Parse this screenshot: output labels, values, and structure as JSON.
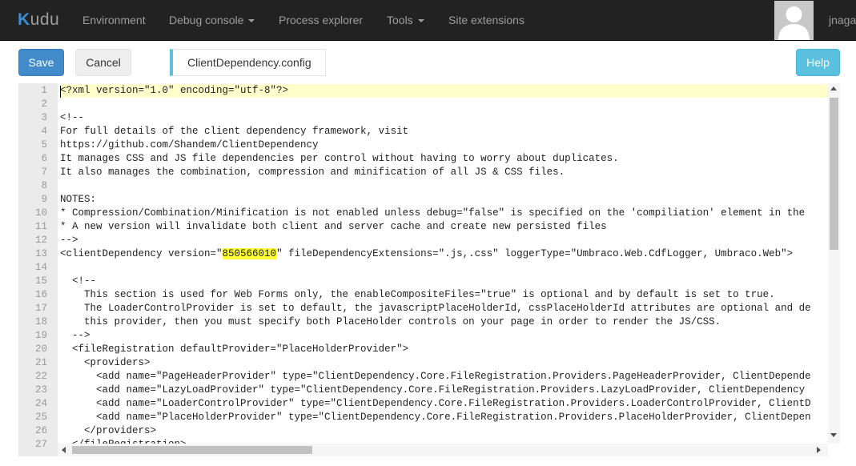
{
  "navbar": {
    "brand_first": "K",
    "brand_rest": "udu",
    "items": [
      {
        "label": "Environment",
        "dropdown": false
      },
      {
        "label": "Debug console",
        "dropdown": true
      },
      {
        "label": "Process explorer",
        "dropdown": false
      },
      {
        "label": "Tools",
        "dropdown": true
      },
      {
        "label": "Site extensions",
        "dropdown": false
      }
    ],
    "avatar_icon": "user-silhouette-icon",
    "username": "jnaga"
  },
  "toolbar": {
    "save_label": "Save",
    "cancel_label": "Cancel",
    "file_name": "ClientDependency.config",
    "help_label": "Help"
  },
  "editor": {
    "active_line": 1,
    "highlight_color": "#ffff33",
    "lines": [
      {
        "n": "1",
        "t": "<?xml version=\"1.0\" encoding=\"utf-8\"?>"
      },
      {
        "n": "2",
        "t": ""
      },
      {
        "n": "3",
        "t": "<!--"
      },
      {
        "n": "4",
        "t": "For full details of the client dependency framework, visit"
      },
      {
        "n": "5",
        "t": "https://github.com/Shandem/ClientDependency"
      },
      {
        "n": "6",
        "t": "It manages CSS and JS file dependencies per control without having to worry about duplicates."
      },
      {
        "n": "7",
        "t": "It also manages the combination, compression and minification of all JS & CSS files."
      },
      {
        "n": "8",
        "t": ""
      },
      {
        "n": "9",
        "t": "NOTES:"
      },
      {
        "n": "10",
        "t": "* Compression/Combination/Minification is not enabled unless debug=\"false\" is specified on the 'compiliation' element in the"
      },
      {
        "n": "11",
        "t": "* A new version will invalidate both client and server cache and create new persisted files"
      },
      {
        "n": "12",
        "t": "-->"
      },
      {
        "n": "13",
        "pre": "<clientDependency version=\"",
        "hl": "850566010",
        "post": "\" fileDependencyExtensions=\".js,.css\" loggerType=\"Umbraco.Web.CdfLogger, Umbraco.Web\">"
      },
      {
        "n": "14",
        "t": ""
      },
      {
        "n": "15",
        "t": "  <!--"
      },
      {
        "n": "16",
        "t": "    This section is used for Web Forms only, the enableCompositeFiles=\"true\" is optional and by default is set to true."
      },
      {
        "n": "17",
        "t": "    The LoaderControlProvider is set to default, the javascriptPlaceHolderId, cssPlaceHolderId attributes are optional and de"
      },
      {
        "n": "18",
        "t": "    this provider, then you must specify both PlaceHolder controls on your page in order to render the JS/CSS."
      },
      {
        "n": "19",
        "t": "  -->"
      },
      {
        "n": "20",
        "t": "  <fileRegistration defaultProvider=\"PlaceHolderProvider\">"
      },
      {
        "n": "21",
        "t": "    <providers>"
      },
      {
        "n": "22",
        "t": "      <add name=\"PageHeaderProvider\" type=\"ClientDependency.Core.FileRegistration.Providers.PageHeaderProvider, ClientDepende"
      },
      {
        "n": "23",
        "t": "      <add name=\"LazyLoadProvider\" type=\"ClientDependency.Core.FileRegistration.Providers.LazyLoadProvider, ClientDependency"
      },
      {
        "n": "24",
        "t": "      <add name=\"LoaderControlProvider\" type=\"ClientDependency.Core.FileRegistration.Providers.LoaderControlProvider, ClientD"
      },
      {
        "n": "25",
        "t": "      <add name=\"PlaceHolderProvider\" type=\"ClientDependency.Core.FileRegistration.Providers.PlaceHolderProvider, ClientDepen"
      },
      {
        "n": "26",
        "t": "    </providers>"
      },
      {
        "n": "27",
        "t": "  </fileRegistration>"
      }
    ]
  }
}
